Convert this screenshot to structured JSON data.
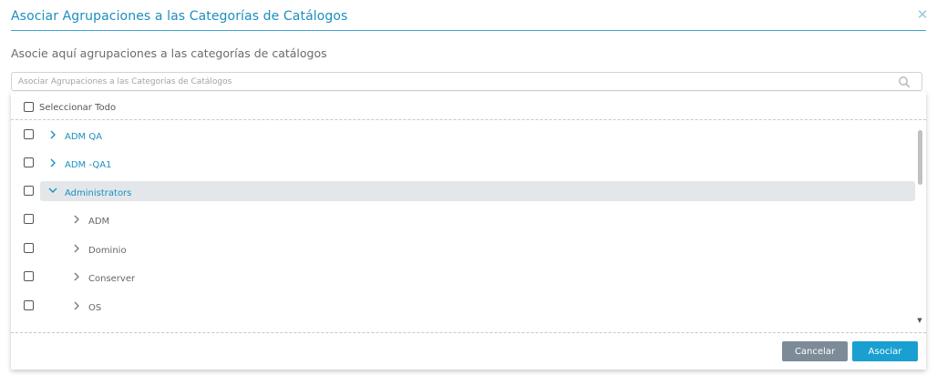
{
  "dialog": {
    "title": "Asociar Agrupaciones a las Categorías de Catálogos",
    "close_icon": "close-icon",
    "subtitle": "Asocie aquí agrupaciones a las categorías de catálogos"
  },
  "search": {
    "placeholder": "Asociar Agrupaciones a las Categorías de Catálogos",
    "value": "",
    "icon": "search-icon"
  },
  "tree": {
    "select_all_label": "Seleccionar Todo",
    "items": [
      {
        "label": "ADM QA",
        "level": 0,
        "expanded": false,
        "highlighted": false
      },
      {
        "label": "ADM -QA1",
        "level": 0,
        "expanded": false,
        "highlighted": false
      },
      {
        "label": "Administrators",
        "level": 0,
        "expanded": true,
        "highlighted": true
      },
      {
        "label": "ADM",
        "level": 1,
        "expanded": false,
        "highlighted": false
      },
      {
        "label": "Dominio",
        "level": 1,
        "expanded": false,
        "highlighted": false
      },
      {
        "label": "Conserver",
        "level": 1,
        "expanded": false,
        "highlighted": false
      },
      {
        "label": "OS",
        "level": 1,
        "expanded": false,
        "highlighted": false
      }
    ]
  },
  "buttons": {
    "cancel_label": "Cancelar",
    "ok_label": "Asociar"
  },
  "colors": {
    "accent": "#1a8fc0",
    "primary_button": "#1a9fd1",
    "secondary_button": "#7d8b99",
    "highlight_row": "#e4e7ea"
  }
}
